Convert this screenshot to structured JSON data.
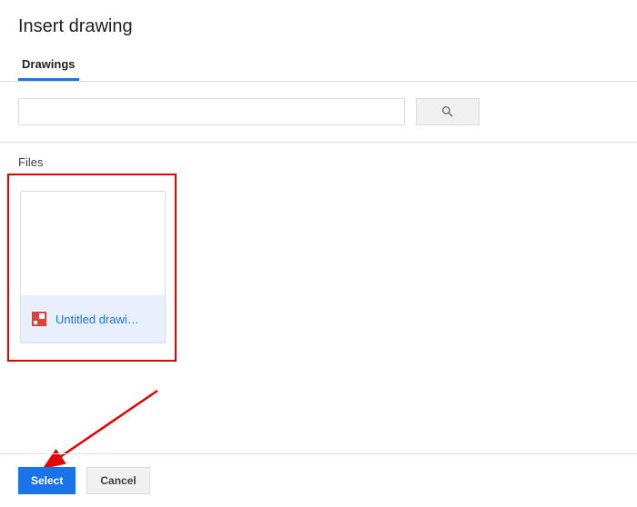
{
  "dialog": {
    "title": "Insert drawing"
  },
  "tabs": {
    "active": "Drawings"
  },
  "search": {
    "value": "",
    "placeholder": ""
  },
  "files": {
    "label": "Files",
    "items": [
      {
        "name": "Untitled drawi…",
        "icon": "google-drawings"
      }
    ]
  },
  "footer": {
    "select_label": "Select",
    "cancel_label": "Cancel"
  },
  "colors": {
    "primary": "#1a73e8",
    "highlight": "#e60000"
  }
}
